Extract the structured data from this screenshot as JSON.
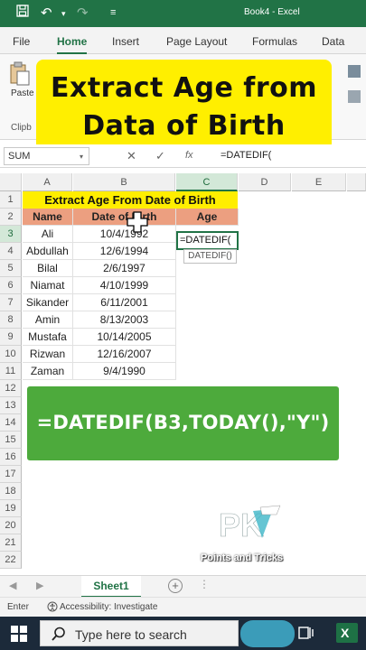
{
  "titlebar": {
    "title": "Book4 - Excel",
    "save_icon": "save-icon",
    "undo_icon": "undo-icon",
    "redo_icon": "redo-icon"
  },
  "ribbon_tabs": [
    "File",
    "Home",
    "Insert",
    "Page Layout",
    "Formulas",
    "Data"
  ],
  "ribbon": {
    "paste_label": "Paste",
    "clipboard_label": "Clipb"
  },
  "banner": {
    "line1": "Extract Age from",
    "line2": "Data of Birth"
  },
  "formula_bar": {
    "name_box": "SUM",
    "cancel": "✕",
    "enter": "✓",
    "fx": "fx",
    "content": "=DATEDIF("
  },
  "columns": [
    "A",
    "B",
    "C",
    "D",
    "E"
  ],
  "rows": [
    "1",
    "2",
    "3",
    "4",
    "5",
    "6",
    "7",
    "8",
    "9",
    "10",
    "11",
    "12",
    "13",
    "14",
    "15",
    "16",
    "17",
    "18",
    "19",
    "20",
    "21",
    "22"
  ],
  "sheet": {
    "title": "Extract Age From Date of Birth",
    "headers": [
      "Name",
      "Date of Birth",
      "Age"
    ],
    "data": [
      {
        "name": "Ali",
        "dob": "10/4/1992"
      },
      {
        "name": "Abdullah",
        "dob": "12/6/1994"
      },
      {
        "name": "Bilal",
        "dob": "2/6/1997"
      },
      {
        "name": "Niamat",
        "dob": "4/10/1999"
      },
      {
        "name": "Sikander",
        "dob": "6/11/2001"
      },
      {
        "name": "Amin",
        "dob": "8/13/2003"
      },
      {
        "name": "Mustafa",
        "dob": "10/14/2005"
      },
      {
        "name": "Rizwan",
        "dob": "12/16/2007"
      },
      {
        "name": "Zaman",
        "dob": "9/4/1990"
      }
    ],
    "active_cell_value": "=DATEDIF(",
    "tooltip": "DATEDIF()"
  },
  "formula_overlay": "=DATEDIF(B3,TODAY(),\"Y\")",
  "logo_text": "Points and Tricks",
  "sheet_tabs": {
    "active": "Sheet1"
  },
  "status": {
    "mode": "Enter",
    "accessibility": "Accessibility: Investigate"
  },
  "taskbar": {
    "search_placeholder": "Type here to search"
  },
  "colors": {
    "excel_green": "#217346",
    "banner_yellow": "#ffef00",
    "header_orange": "#ec9f80",
    "overlay_green": "#4daa3c"
  }
}
